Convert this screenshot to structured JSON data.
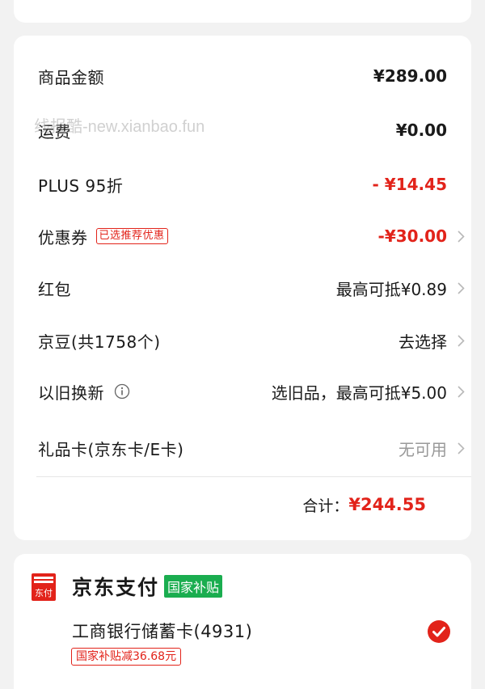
{
  "watermark": "线报酷-new.xianbao.fun",
  "order": {
    "rows": [
      {
        "label": "商品金额",
        "value": "¥289.00"
      },
      {
        "label": "运费",
        "value": "¥0.00"
      },
      {
        "label": "PLUS 95折",
        "value": "- ¥14.45"
      },
      {
        "label": "优惠券",
        "tag": "已选推荐优惠",
        "value": "-¥30.00"
      },
      {
        "label": "红包",
        "value": "最高可抵¥0.89"
      },
      {
        "label": "京豆(共1758个)",
        "value": "去选择"
      },
      {
        "label": "以旧换新",
        "value": "选旧品，最高可抵¥5.00"
      },
      {
        "label": "礼品卡(京东卡/E卡)",
        "value": "无可用"
      }
    ],
    "total_label": "合计：",
    "total_value": "¥244.55"
  },
  "payment": {
    "icon_label": "东付",
    "method": "京东支付",
    "method_tag": "国家补贴",
    "bank": "工商银行储蓄卡(4931)",
    "bank_tag": "国家补贴减36.68元"
  },
  "colors": {
    "accent_red": "#e2231a",
    "green_tag": "#1aad4f",
    "background": "#f2f2f2"
  }
}
